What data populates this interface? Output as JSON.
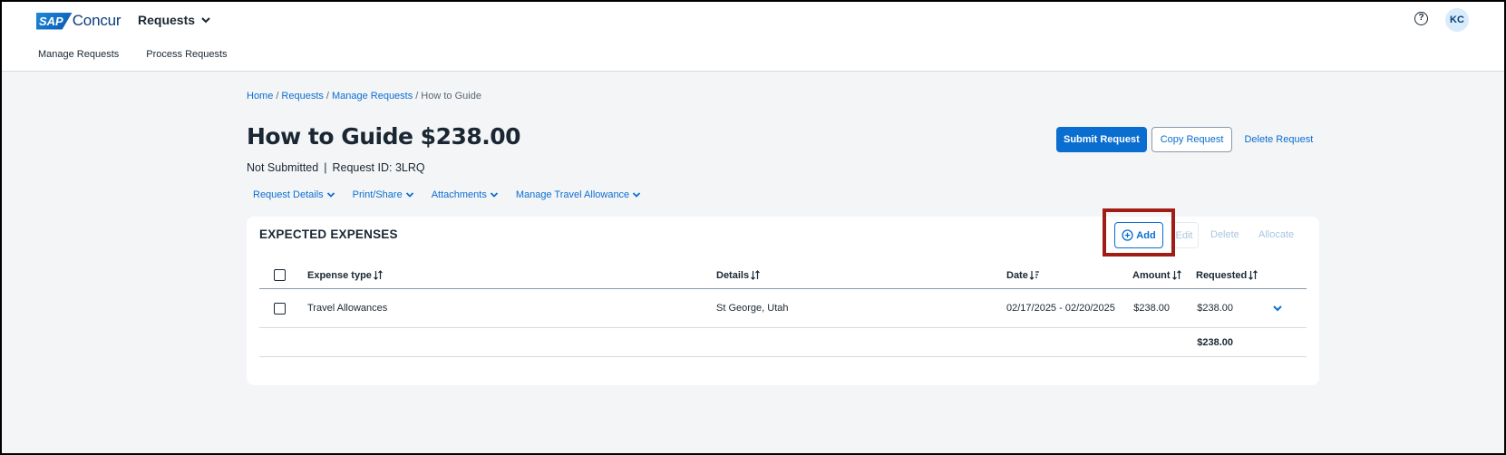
{
  "header": {
    "logo_sap": "SAP",
    "logo_concur": "Concur",
    "app_menu_label": "Requests",
    "avatar_initials": "KC",
    "help_glyph": "?"
  },
  "subnav": {
    "items": [
      "Manage Requests",
      "Process Requests"
    ]
  },
  "breadcrumb": {
    "items": [
      "Home",
      "Requests",
      "Manage Requests",
      "How to Guide"
    ]
  },
  "request": {
    "title": "How to Guide $238.00",
    "status": "Not Submitted",
    "request_id_label": "Request ID: 3LRQ"
  },
  "actions": {
    "submit": "Submit Request",
    "copy": "Copy Request",
    "delete": "Delete Request"
  },
  "tabs": [
    "Request Details",
    "Print/Share",
    "Attachments",
    "Manage Travel Allowance"
  ],
  "expenses": {
    "section_title": "EXPECTED EXPENSES",
    "toolbar": {
      "add": "Add",
      "edit": "Edit",
      "delete": "Delete",
      "allocate": "Allocate"
    },
    "columns": {
      "expense_type": "Expense type",
      "details": "Details",
      "date": "Date",
      "amount": "Amount",
      "requested": "Requested"
    },
    "rows": [
      {
        "expense_type": "Travel Allowances",
        "details": "St George, Utah",
        "date": "02/17/2025 - 02/20/2025",
        "amount": "$238.00",
        "requested": "$238.00"
      }
    ],
    "total_requested": "$238.00"
  },
  "icons": {
    "app_menu": "chevron-down-icon",
    "help": "help-circle-icon",
    "add": "plus-circle-icon",
    "sort": "sort-arrows-icon",
    "row_expand": "chevron-down-icon"
  },
  "colors": {
    "accent": "#0a6ed1",
    "highlight_box": "#a01c14",
    "page_background": "#f4f5f7",
    "disabled_text": "#a9c5e2"
  }
}
